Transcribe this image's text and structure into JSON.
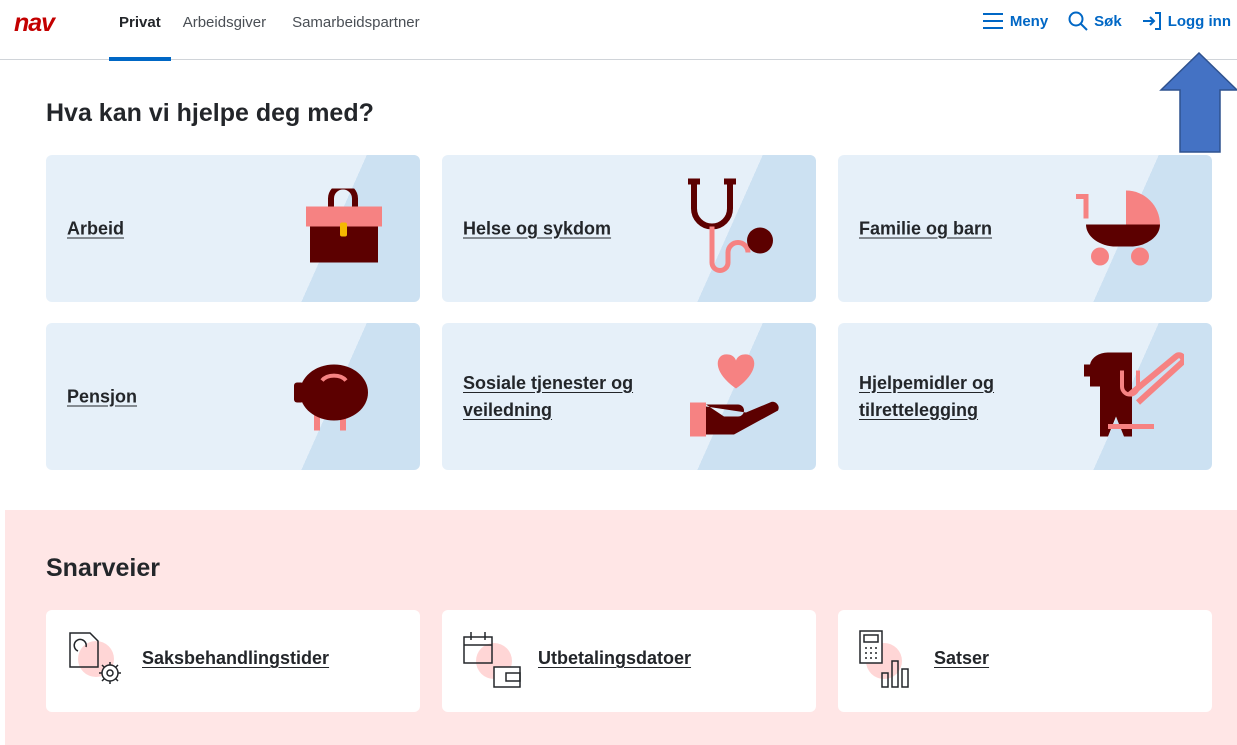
{
  "header": {
    "logo_text": "nav",
    "tabs": [
      {
        "label": "Privat",
        "active": true
      },
      {
        "label": "Arbeidsgiver",
        "active": false
      },
      {
        "label": "Samarbeidspartner",
        "active": false
      }
    ],
    "menu_label": "Meny",
    "search_label": "Søk",
    "login_label": "Logg inn"
  },
  "main": {
    "title": "Hva kan vi hjelpe deg med?",
    "cards": [
      {
        "label": "Arbeid",
        "icon": "briefcase-illustration"
      },
      {
        "label": "Helse og sykdom",
        "icon": "stethoscope-illustration"
      },
      {
        "label": "Familie og barn",
        "icon": "stroller-illustration"
      },
      {
        "label": "Pensjon",
        "icon": "piggy-bank-illustration"
      },
      {
        "label": "Sosiale tjenester og veiledning",
        "icon": "hand-heart-illustration"
      },
      {
        "label": "Hjelpemidler og tilrettelegging",
        "icon": "guide-dog-illustration"
      }
    ]
  },
  "shortcuts": {
    "title": "Snarveier",
    "items": [
      {
        "label": "Saksbehandlingstider",
        "icon": "document-gear-icon"
      },
      {
        "label": "Utbetalingsdatoer",
        "icon": "calendar-wallet-icon"
      },
      {
        "label": "Satser",
        "icon": "calculator-chart-icon"
      }
    ]
  },
  "colors": {
    "accent": "#0067c5",
    "brand_red": "#c30000",
    "card_bg": "#e6f0f9",
    "card_bg_alt": "#cce1f2",
    "illus_dark": "#5c0000",
    "illus_pink": "#f68282",
    "shortcut_bg": "#ffe6e6",
    "arrow_fill": "#4472c4"
  }
}
